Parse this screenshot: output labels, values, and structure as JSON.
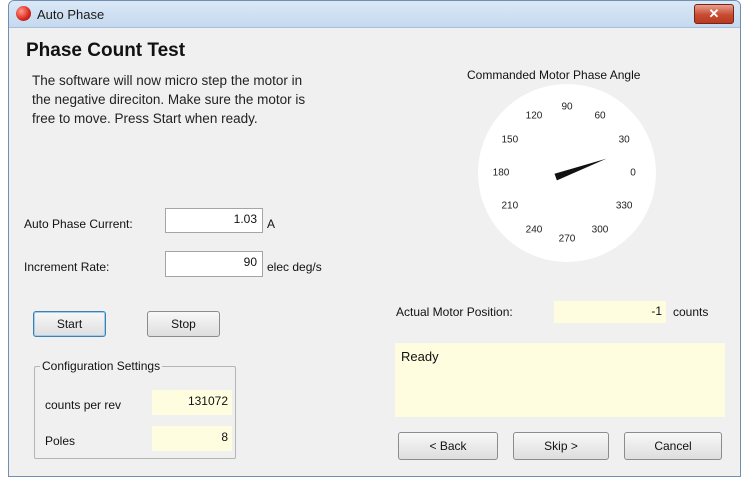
{
  "window": {
    "title": "Auto Phase",
    "close_label": "✕"
  },
  "page": {
    "heading": "Phase Count Test",
    "instructions": [
      "The software will now micro step the motor in",
      "the negative direciton.  Make sure the motor is",
      "free to move. Press Start when ready."
    ]
  },
  "settings": {
    "current_label": "Auto Phase Current:",
    "current_value": "1.03",
    "current_unit": "A",
    "rate_label": "Increment Rate:",
    "rate_value": "90",
    "rate_unit": "elec deg/s"
  },
  "buttons": {
    "start": "Start",
    "stop": "Stop",
    "back": "< Back",
    "skip": "Skip >",
    "cancel": "Cancel"
  },
  "config": {
    "title": "Configuration Settings",
    "counts_label": "counts per rev",
    "counts_value": "131072",
    "poles_label": "Poles",
    "poles_value": "8"
  },
  "dial": {
    "title": "Commanded Motor Phase Angle",
    "angle_deg": 20,
    "labels": [
      "0",
      "30",
      "60",
      "90",
      "120",
      "150",
      "180",
      "210",
      "240",
      "270",
      "300",
      "330"
    ]
  },
  "position": {
    "label": "Actual Motor Position:",
    "value": "-1",
    "unit": "counts"
  },
  "status": {
    "text": "Ready"
  }
}
